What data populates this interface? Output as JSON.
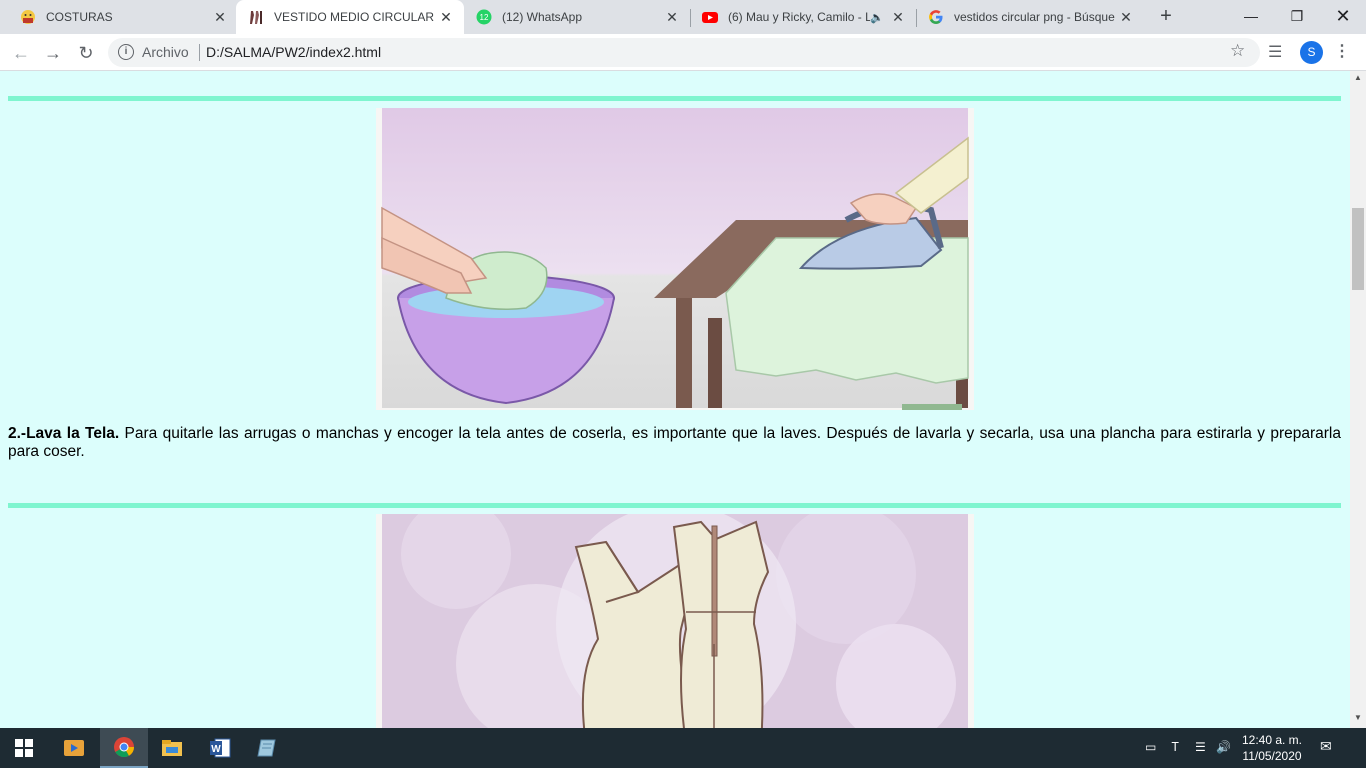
{
  "browser": {
    "tabs": [
      {
        "title": "COSTURAS",
        "icon": "emoji-face-icon",
        "active": false
      },
      {
        "title": "VESTIDO MEDIO CIRCULAR",
        "icon": "dress-icon",
        "active": true
      },
      {
        "title": "(12) WhatsApp",
        "icon": "whatsapp-icon",
        "badge": "12",
        "active": false
      },
      {
        "title": "(6) Mau y Ricky, Camilo - L",
        "icon": "youtube-icon",
        "audio": true,
        "active": false
      },
      {
        "title": "vestidos circular png - Búsque",
        "icon": "google-icon",
        "active": false
      }
    ],
    "close_glyph": "✕",
    "new_tab_glyph": "+",
    "address": {
      "chip": "Archivo",
      "url": "D:/SALMA/PW2/index2.html"
    },
    "profile_initial": "S"
  },
  "page": {
    "background": "#dcfefc",
    "rule_color": "#7ff5cf",
    "step2": {
      "title": "2.-Lava la Tela.",
      "text": " Para quitarle las arrugas o manchas y encoger la tela antes de coserla, es importante que la laves. Después de lavarla y secarla, usa una plancha para estirarla y prepararla para coser."
    },
    "images": [
      {
        "name": "wash-and-iron-illustration",
        "icon": "wash-iron-illustration"
      },
      {
        "name": "dress-pattern-illustration",
        "icon": "dress-pattern-illustration"
      }
    ]
  },
  "taskbar": {
    "time": "12:40 a. m.",
    "date": "11/05/2020",
    "apps": [
      "start-icon",
      "media-player-icon",
      "chrome-icon",
      "file-explorer-icon",
      "word-icon",
      "notepad-icon"
    ]
  }
}
